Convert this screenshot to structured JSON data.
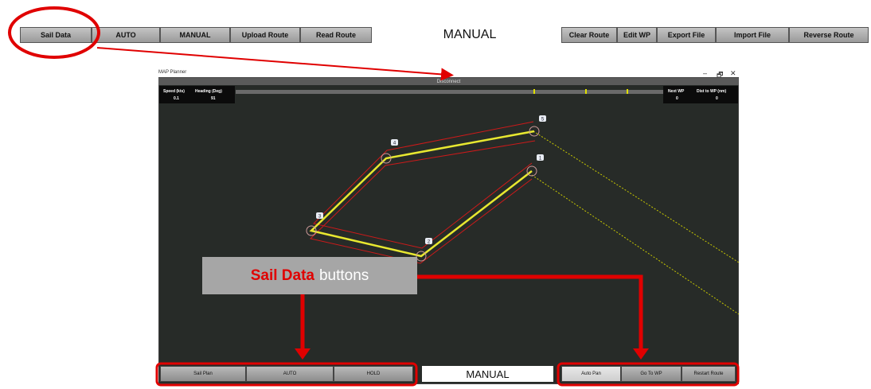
{
  "toolbar": {
    "left_buttons": [
      "Sail Data",
      "AUTO",
      "MANUAL",
      "Upload Route",
      "Read Route"
    ],
    "mode": "MANUAL",
    "right_buttons": [
      "Clear Route",
      "Edit WP",
      "Export File",
      "Import File",
      "Reverse Route"
    ]
  },
  "window": {
    "title": "MAP Planner",
    "disconnect_label": "Disconnect",
    "controls": [
      "–",
      "🗗",
      "✕"
    ]
  },
  "info_left": {
    "speed_label": "Speed (kts)",
    "speed_value": "0.1",
    "heading_label": "Heading (Deg)",
    "heading_value": "91"
  },
  "info_right": {
    "next_wp_label": "Next WP",
    "next_wp_value": "0",
    "dist_label": "Dist to WP (nm)",
    "dist_value": "0"
  },
  "waypoints": [
    "1",
    "2",
    "3",
    "4",
    "5"
  ],
  "bottom": {
    "left_buttons": [
      "Sail Plan",
      "AUTO",
      "HOLD"
    ],
    "mode": "MANUAL",
    "right_buttons": [
      "Auto Pan",
      "Go To WP",
      "Restart Route"
    ]
  },
  "annotation": {
    "highlight": "Sail Data",
    "rest": "buttons",
    "highlight_color": "#e00000"
  }
}
